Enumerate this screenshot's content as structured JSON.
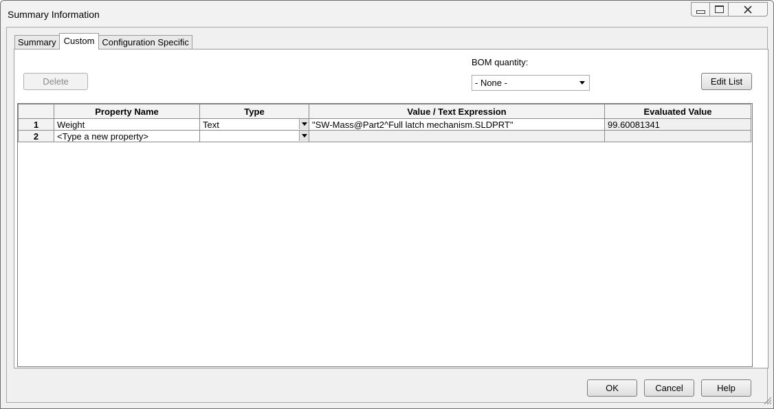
{
  "window": {
    "title": "Summary Information",
    "controls": [
      "minimize-icon",
      "maximize-icon",
      "close-icon"
    ]
  },
  "tabs": [
    {
      "label": "Summary",
      "active": false
    },
    {
      "label": "Custom",
      "active": true
    },
    {
      "label": "Configuration Specific",
      "active": false
    }
  ],
  "toolbar": {
    "delete_label": "Delete",
    "bom_label": "BOM quantity:",
    "bom_value": "- None -",
    "edit_list_label": "Edit List"
  },
  "grid": {
    "columns": [
      "",
      "Property Name",
      "Type",
      "Value / Text Expression",
      "Evaluated Value"
    ],
    "rows": [
      {
        "num": "1",
        "name": "Weight",
        "type": "Text",
        "value": "\"SW-Mass@Part2^Full latch mechanism.SLDPRT\"",
        "evaluated": "99.60081341"
      },
      {
        "num": "2",
        "name": "<Type a new property>",
        "type": "",
        "value": "",
        "evaluated": ""
      }
    ]
  },
  "footer": {
    "ok_label": "OK",
    "cancel_label": "Cancel",
    "help_label": "Help"
  }
}
